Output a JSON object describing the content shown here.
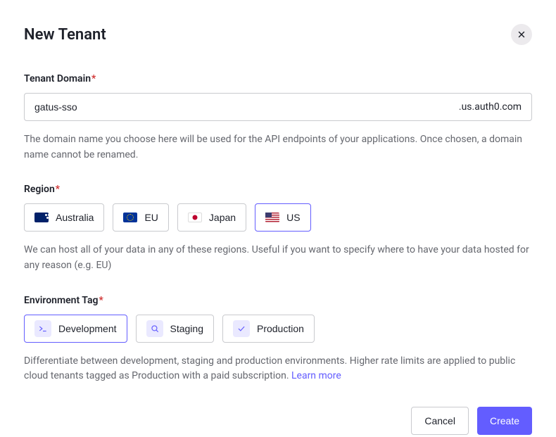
{
  "header": {
    "title": "New Tenant"
  },
  "domain": {
    "label": "Tenant Domain",
    "required": "*",
    "value": "gatus-sso",
    "suffix": ".us.auth0.com",
    "helper": "The domain name you choose here will be used for the API endpoints of your applications. Once chosen, a domain name cannot be renamed."
  },
  "region": {
    "label": "Region",
    "required": "*",
    "options": {
      "au": "Australia",
      "eu": "EU",
      "jp": "Japan",
      "us": "US"
    },
    "selected": "us",
    "helper": "We can host all of your data in any of these regions. Useful if you want to specify where to have your data hosted for any reason (e.g. EU)"
  },
  "env": {
    "label": "Environment Tag",
    "required": "*",
    "options": {
      "dev": "Development",
      "staging": "Staging",
      "prod": "Production"
    },
    "selected": "dev",
    "helper_a": "Differentiate between development, staging and production environments. Higher rate limits are applied to public cloud tenants tagged as Production with a paid subscription. ",
    "learn_more": "Learn more"
  },
  "footer": {
    "cancel": "Cancel",
    "create": "Create"
  }
}
